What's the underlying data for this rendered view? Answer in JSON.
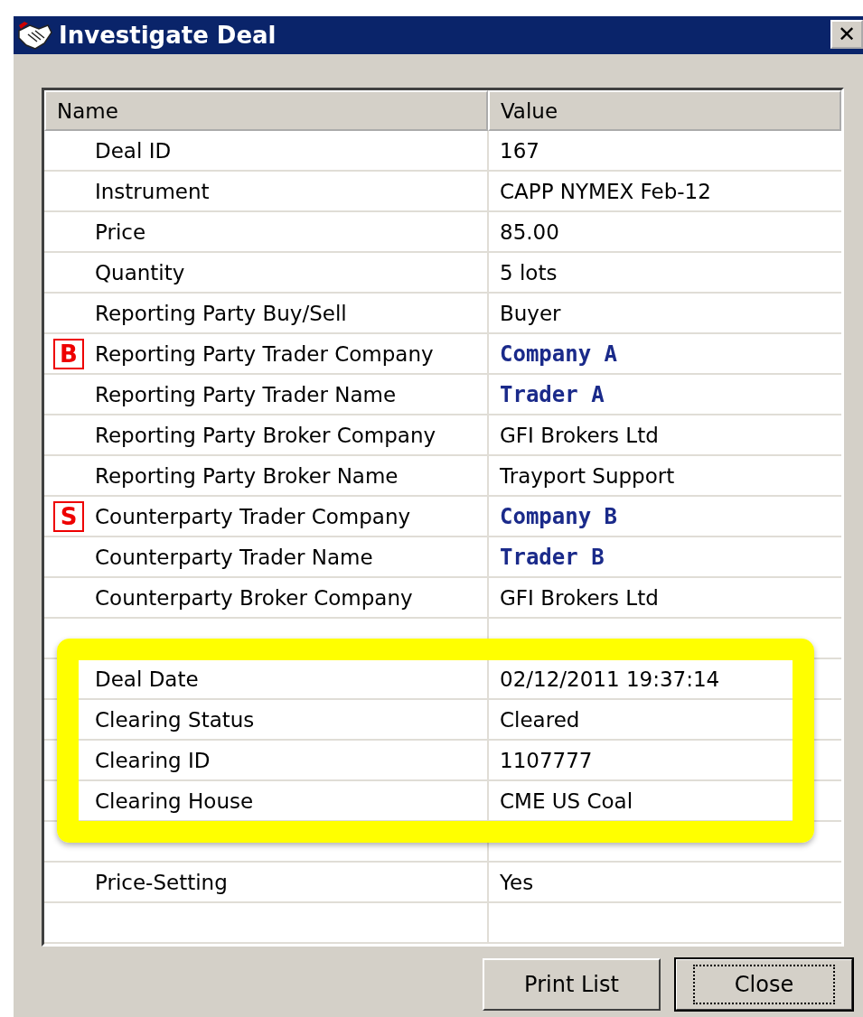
{
  "window": {
    "title": "Investigate Deal",
    "close_glyph": "✕"
  },
  "table": {
    "columns": [
      "Name",
      "Value"
    ],
    "rows": [
      {
        "name": "Deal ID",
        "value": "167"
      },
      {
        "name": "Instrument",
        "value": "CAPP NYMEX Feb-12"
      },
      {
        "name": "Price",
        "value": "85.00"
      },
      {
        "name": "Quantity",
        "value": "5 lots"
      },
      {
        "name": "Reporting Party Buy/Sell",
        "value": "Buyer"
      },
      {
        "name": "Reporting Party Trader Company",
        "value": "Company A",
        "marker": "B",
        "emphasis": true
      },
      {
        "name": "Reporting Party Trader Name",
        "value": "Trader A",
        "emphasis": true
      },
      {
        "name": "Reporting Party Broker Company",
        "value": "GFI Brokers Ltd"
      },
      {
        "name": "Reporting Party Broker Name",
        "value": "Trayport Support"
      },
      {
        "name": "Counterparty Trader Company",
        "value": "Company B",
        "marker": "S",
        "emphasis": true
      },
      {
        "name": "Counterparty Trader Name",
        "value": "Trader B",
        "emphasis": true
      },
      {
        "name": "Counterparty Broker Company",
        "value": "GFI Brokers Ltd"
      }
    ],
    "highlighted_rows": [
      {
        "name": "Deal Date",
        "value": "02/12/2011 19:37:14"
      },
      {
        "name": "Clearing Status",
        "value": "Cleared"
      },
      {
        "name": "Clearing ID",
        "value": "1107777"
      },
      {
        "name": "Clearing House",
        "value": "CME US Coal"
      }
    ],
    "rows_after": [
      {
        "name": "Price-Setting",
        "value": "Yes"
      }
    ]
  },
  "buttons": [
    {
      "label": "Print List",
      "default": false
    },
    {
      "label": "Close",
      "default": true
    }
  ]
}
